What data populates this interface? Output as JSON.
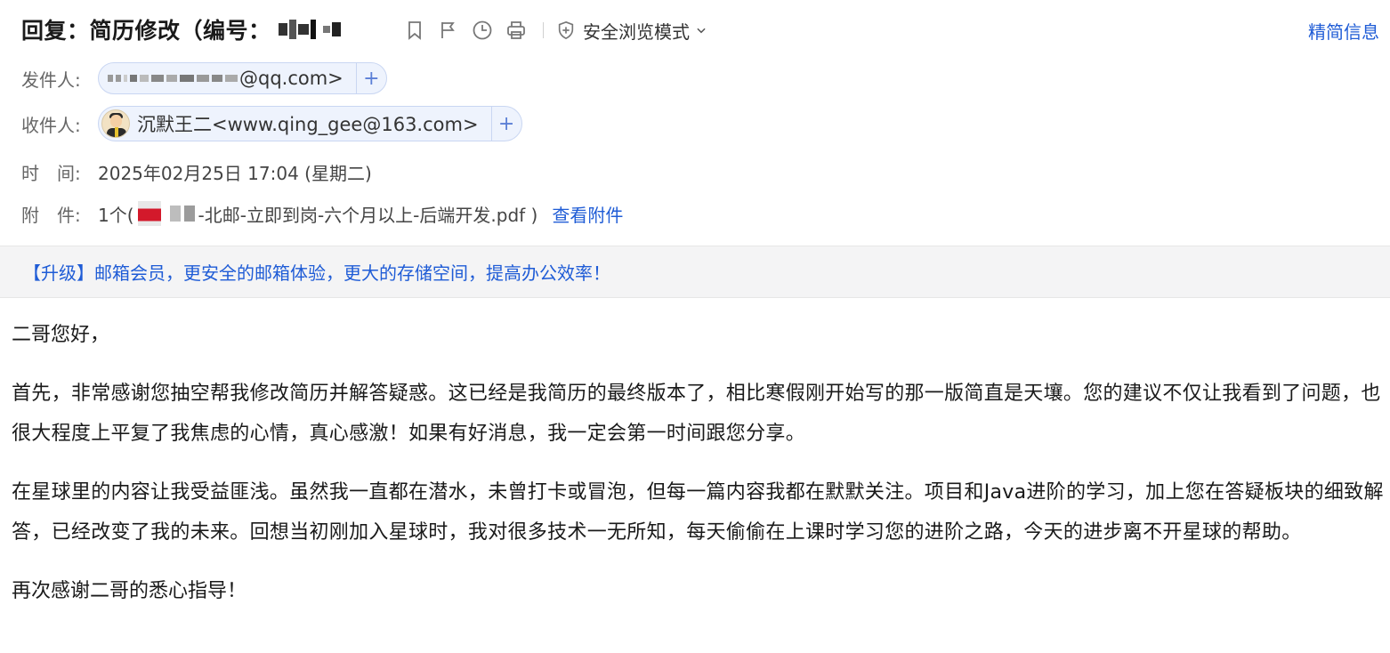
{
  "header": {
    "subject": "回复：简历修改（编号：",
    "safe_mode_label": "安全浏览模式",
    "brief_info_label": "精简信息",
    "tool_icons": [
      "bookmark-icon",
      "flag-icon",
      "clock-icon",
      "print-icon"
    ]
  },
  "sender": {
    "label": "发件人:",
    "email_suffix": "@qq.com>"
  },
  "recipient": {
    "label": "收件人:",
    "name_email": "沉默王二<www.qing_gee@163.com>"
  },
  "time": {
    "label": "时　间:",
    "value": "2025年02月25日 17:04 (星期二)"
  },
  "attachment": {
    "label": "附　件:",
    "count_prefix": "1个(",
    "filename_suffix": "-北邮-立即到岗-六个月以上-后端开发.pdf )",
    "view_link": "查看附件"
  },
  "banner": {
    "text": "【升级】邮箱会员，更安全的邮箱体验，更大的存储空间，提高办公效率！"
  },
  "body": {
    "greeting": "二哥您好，",
    "p1": "首先，非常感谢您抽空帮我修改简历并解答疑惑。这已经是我简历的最终版本了，相比寒假刚开始写的那一版简直是天壤。您的建议不仅让我看到了问题，也很大程度上平复了我焦虑的心情，真心感激！如果有好消息，我一定会第一时间跟您分享。",
    "p2": "在星球里的内容让我受益匪浅。虽然我一直都在潜水，未曾打卡或冒泡，但每一篇内容我都在默默关注。项目和Java进阶的学习，加上您在答疑板块的细致解答，已经改变了我的未来。回想当初刚加入星球时，我对很多技术一无所知，每天偷偷在上课时学习您的进阶之路，今天的进步离不开星球的帮助。",
    "closing": "再次感谢二哥的悉心指导！"
  },
  "colors": {
    "link": "#1f5cd6",
    "banner_bg": "#f4f4f5",
    "chip_bg": "#eef3fd"
  }
}
